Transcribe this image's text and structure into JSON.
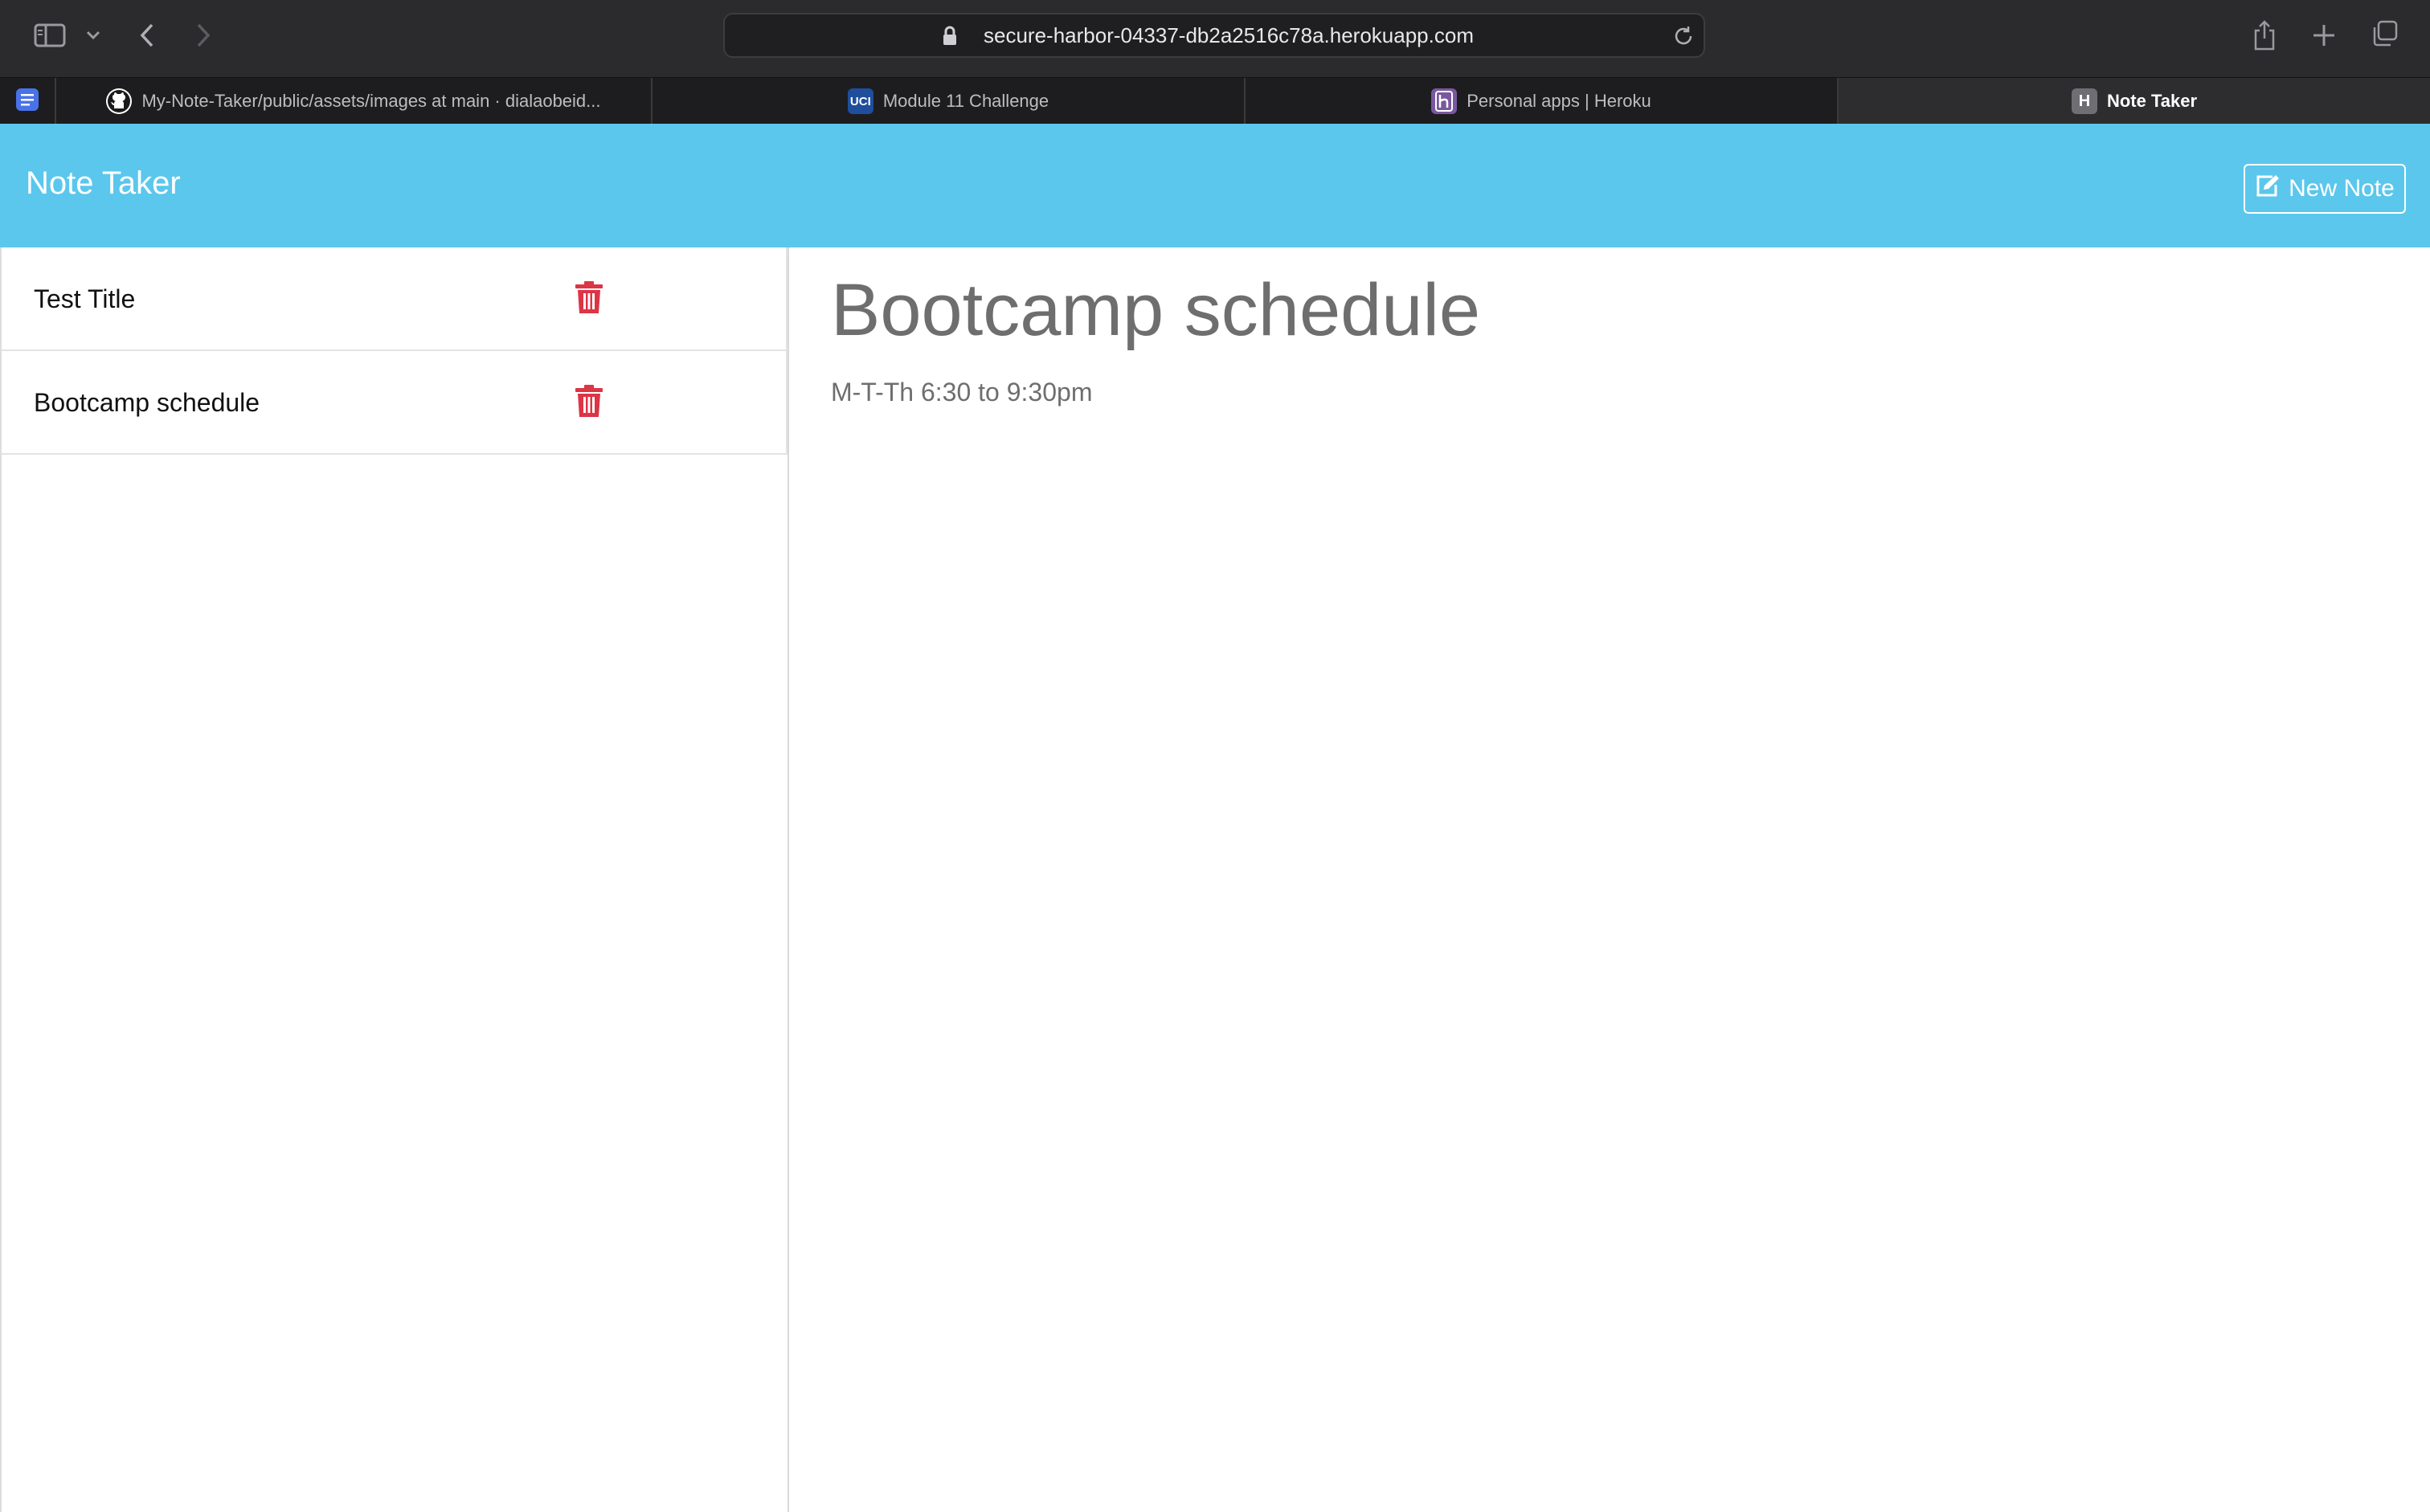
{
  "browser": {
    "url": "secure-harbor-04337-db2a2516c78a.herokuapp.com",
    "tabs": [
      {
        "label": "My-Note-Taker/public/assets/images at main · dialaobeid...",
        "icon": "github-icon"
      },
      {
        "label": "Module 11 Challenge",
        "icon": "uci-icon",
        "favicon_text": "UCI"
      },
      {
        "label": "Personal apps | Heroku",
        "icon": "heroku-icon"
      },
      {
        "label": "Note Taker",
        "icon": "h-icon",
        "favicon_text": "H",
        "active": true
      }
    ]
  },
  "app": {
    "brand": "Note Taker",
    "new_note_label": "New Note",
    "notes": [
      {
        "title": "Test Title"
      },
      {
        "title": "Bootcamp schedule"
      }
    ],
    "active_note": {
      "title": "Bootcamp schedule",
      "text": "M-T-Th 6:30 to 9:30pm"
    },
    "colors": {
      "navbar": "#5bc7ec",
      "delete_icon": "#dc3545"
    }
  }
}
